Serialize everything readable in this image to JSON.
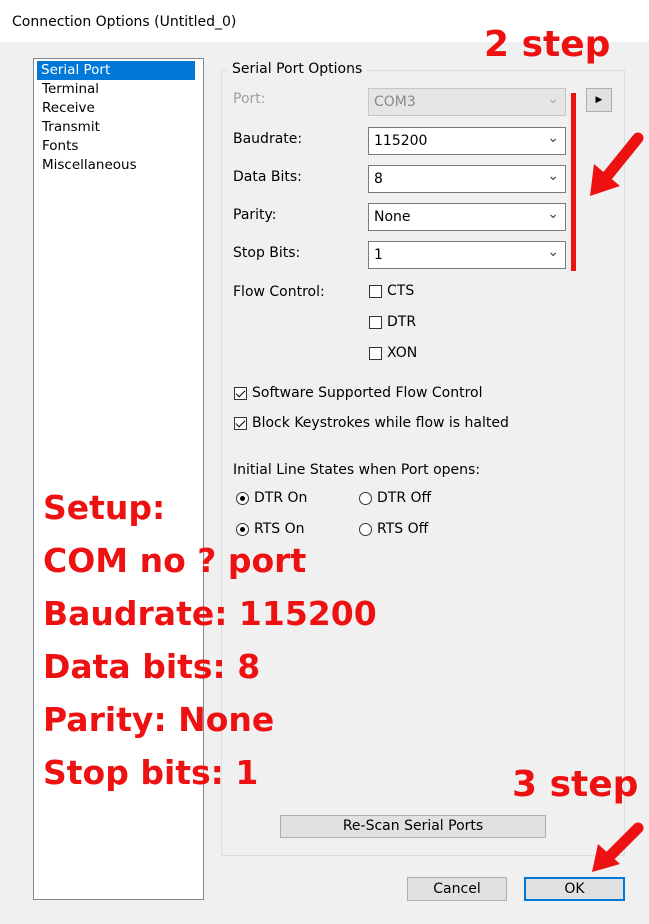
{
  "window": {
    "title": "Connection Options (Untitled_0)"
  },
  "nav": {
    "items": [
      {
        "label": "Serial Port",
        "selected": true
      },
      {
        "label": "Terminal"
      },
      {
        "label": "Receive"
      },
      {
        "label": "Transmit"
      },
      {
        "label": "Fonts"
      },
      {
        "label": "Miscellaneous"
      }
    ]
  },
  "serial": {
    "group_title": "Serial Port Options",
    "port": {
      "label": "Port:",
      "value": "COM3"
    },
    "baudrate": {
      "label": "Baudrate:",
      "value": "115200"
    },
    "data_bits": {
      "label": "Data Bits:",
      "value": "8"
    },
    "parity": {
      "label": "Parity:",
      "value": "None"
    },
    "stop_bits": {
      "label": "Stop Bits:",
      "value": "1"
    },
    "flow_control": {
      "label": "Flow Control:",
      "cts": {
        "label": "CTS",
        "checked": false
      },
      "dtr": {
        "label": "DTR",
        "checked": false
      },
      "xon": {
        "label": "XON",
        "checked": false
      }
    },
    "software_flow": {
      "label": "Software Supported Flow Control",
      "checked": true
    },
    "block_keystrokes": {
      "label": "Block Keystrokes while flow is halted",
      "checked": true
    },
    "line_states": {
      "label": "Initial Line States when Port opens:",
      "dtr_on": {
        "label": "DTR On",
        "checked": true
      },
      "dtr_off": {
        "label": "DTR Off",
        "checked": false
      },
      "rts_on": {
        "label": "RTS On",
        "checked": true
      },
      "rts_off": {
        "label": "RTS Off",
        "checked": false
      }
    },
    "rescan_label": "Re-Scan Serial Ports"
  },
  "buttons": {
    "cancel": "Cancel",
    "ok": "OK"
  },
  "annotations": {
    "step2": "2 step",
    "step3": "3 step",
    "setup": [
      "Setup:",
      "COM no ? port",
      "Baudrate: 115200",
      "Data bits: 8",
      "Parity: None",
      "Stop bits: 1"
    ],
    "color": "#ee1111"
  },
  "icons": {
    "dropdown": "chevron-down-icon",
    "expand": "play-right-icon"
  }
}
